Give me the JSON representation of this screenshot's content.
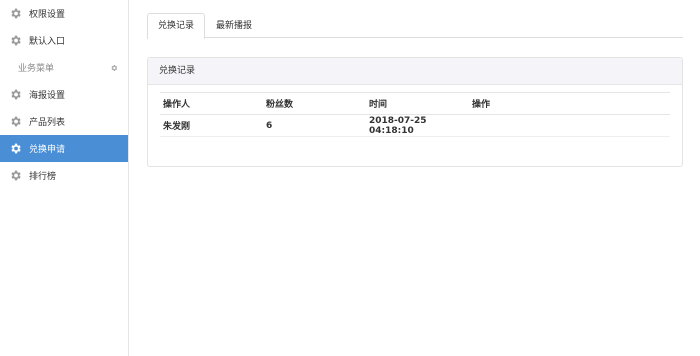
{
  "sidebar": {
    "items_top": [
      {
        "label": "权限设置"
      },
      {
        "label": "默认入口"
      }
    ],
    "group_label": "业务菜单",
    "items": [
      {
        "label": "海报设置"
      },
      {
        "label": "产品列表"
      },
      {
        "label": "兑换申请",
        "active": true
      },
      {
        "label": "排行榜"
      }
    ],
    "active_color": "#4a8fd6"
  },
  "tabs": [
    {
      "label": "兑换记录"
    },
    {
      "label": "最新播报"
    }
  ],
  "panel": {
    "title": "兑换记录",
    "columns": [
      "操作人",
      "粉丝数",
      "时间",
      "操作"
    ],
    "rows": [
      {
        "operator": "朱发刚",
        "fans": "6",
        "time": "2018-07-25 04:18:10",
        "action": ""
      }
    ]
  }
}
